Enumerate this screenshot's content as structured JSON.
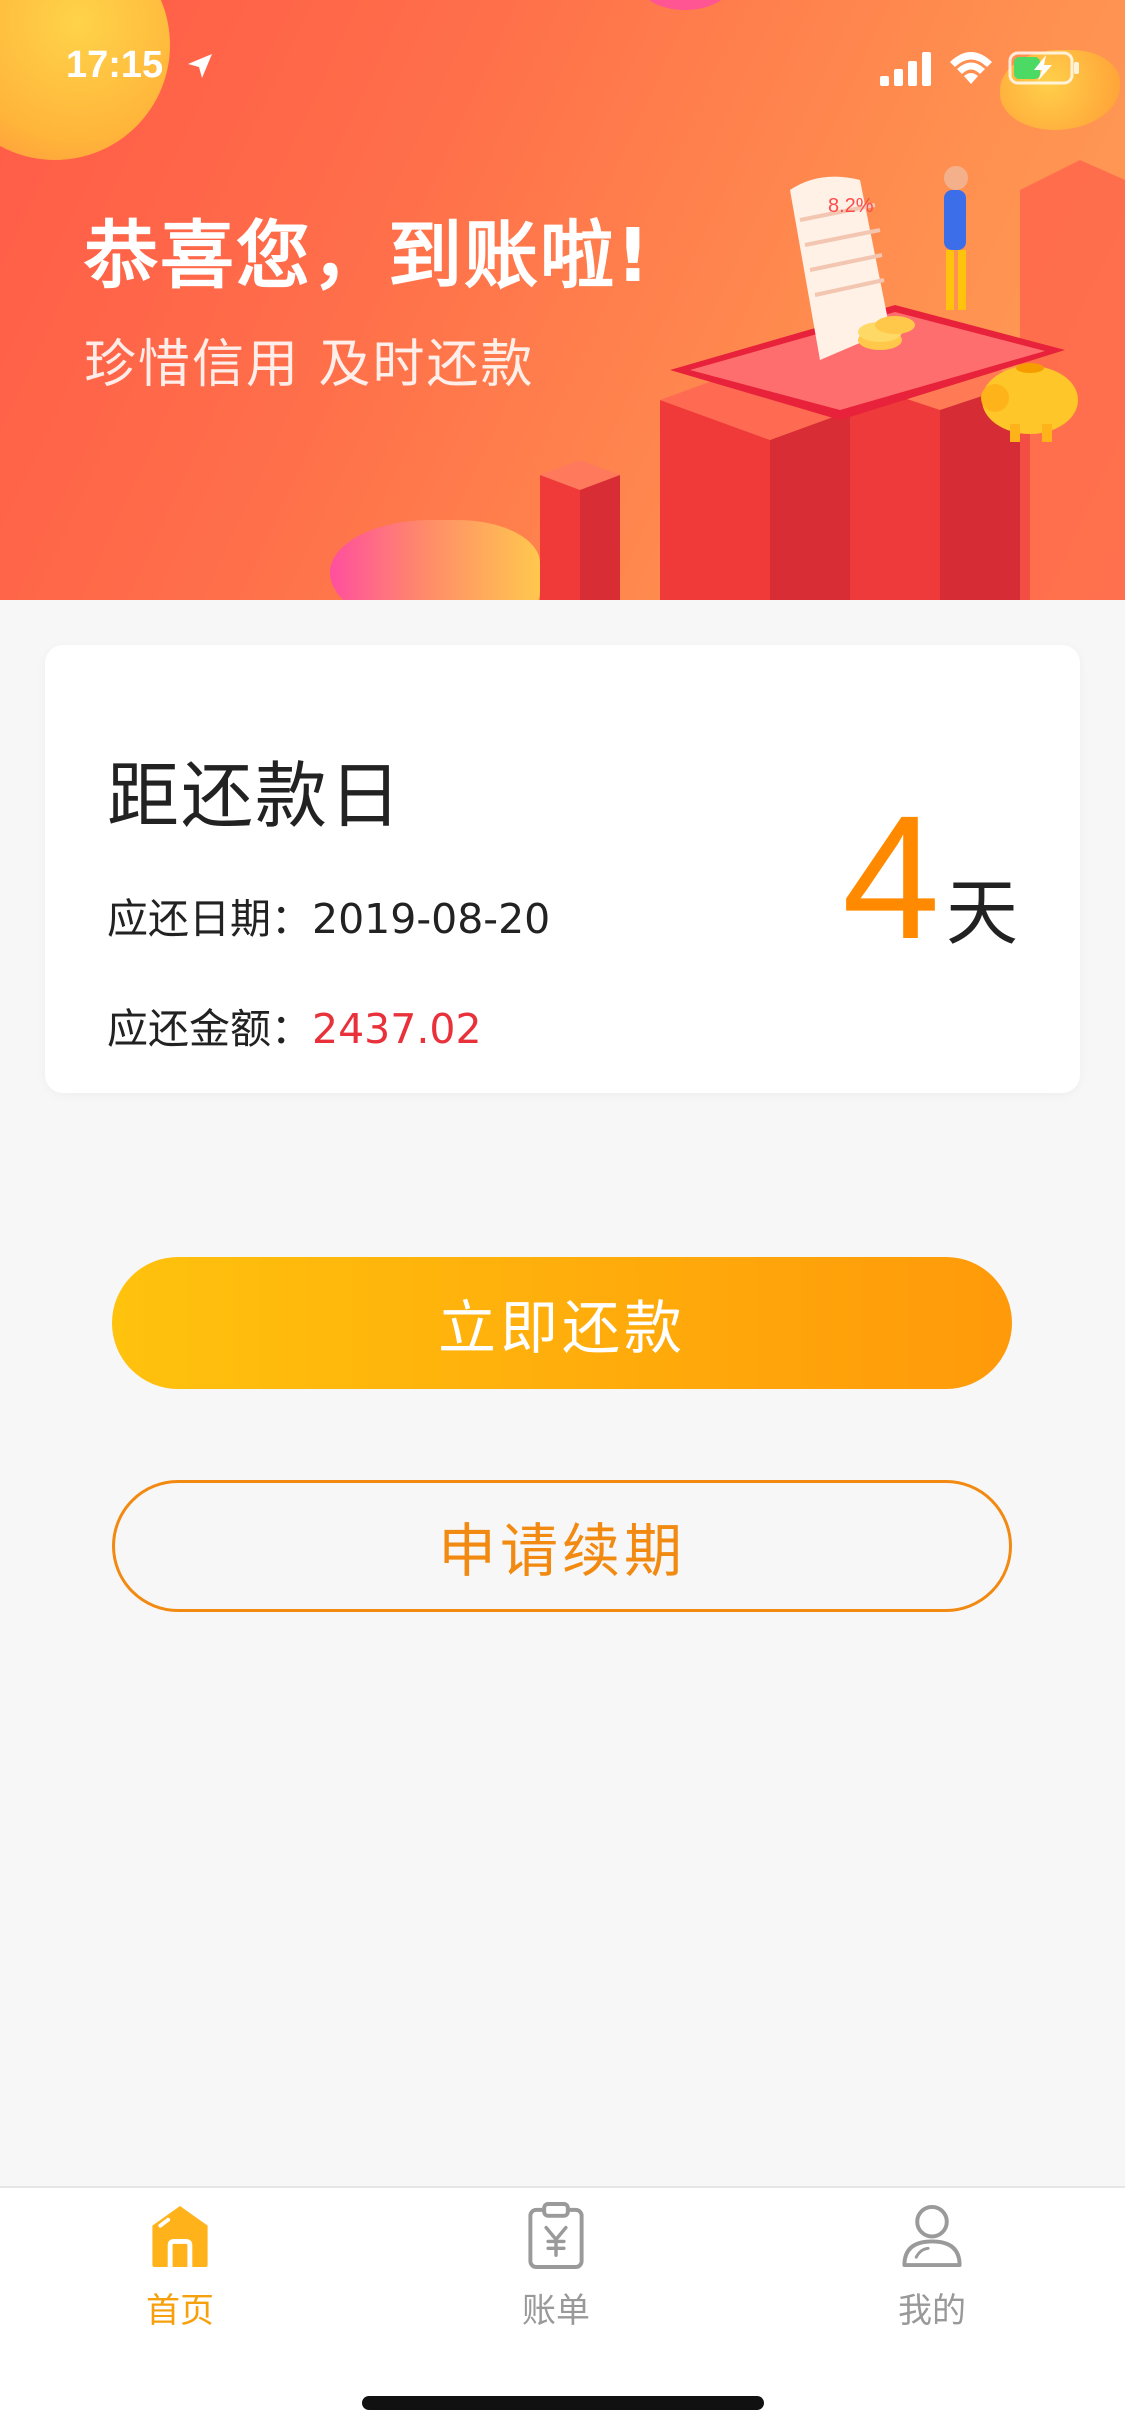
{
  "status_bar": {
    "time": "17:15"
  },
  "hero": {
    "title": "恭喜您，到账啦!",
    "subtitle": "珍惜信用 及时还款",
    "receipt_text": "8.2%"
  },
  "repayment_card": {
    "title": "距还款日",
    "due_date_label": "应还日期：",
    "due_date_value": "2019-08-20",
    "amount_label": "应还金额：",
    "amount_value": "2437.02",
    "days_remaining": "4",
    "days_unit": "天"
  },
  "buttons": {
    "repay_now": "立即还款",
    "apply_renewal": "申请续期"
  },
  "tab_bar": {
    "items": [
      {
        "label": "首页",
        "icon": "home-icon",
        "active": true
      },
      {
        "label": "账单",
        "icon": "bill-icon",
        "active": false
      },
      {
        "label": "我的",
        "icon": "profile-icon",
        "active": false
      }
    ]
  },
  "colors": {
    "accent_orange": "#ff8a00",
    "amount_red": "#e8313a",
    "tab_active": "#f5a00c",
    "tab_inactive": "#999999"
  }
}
